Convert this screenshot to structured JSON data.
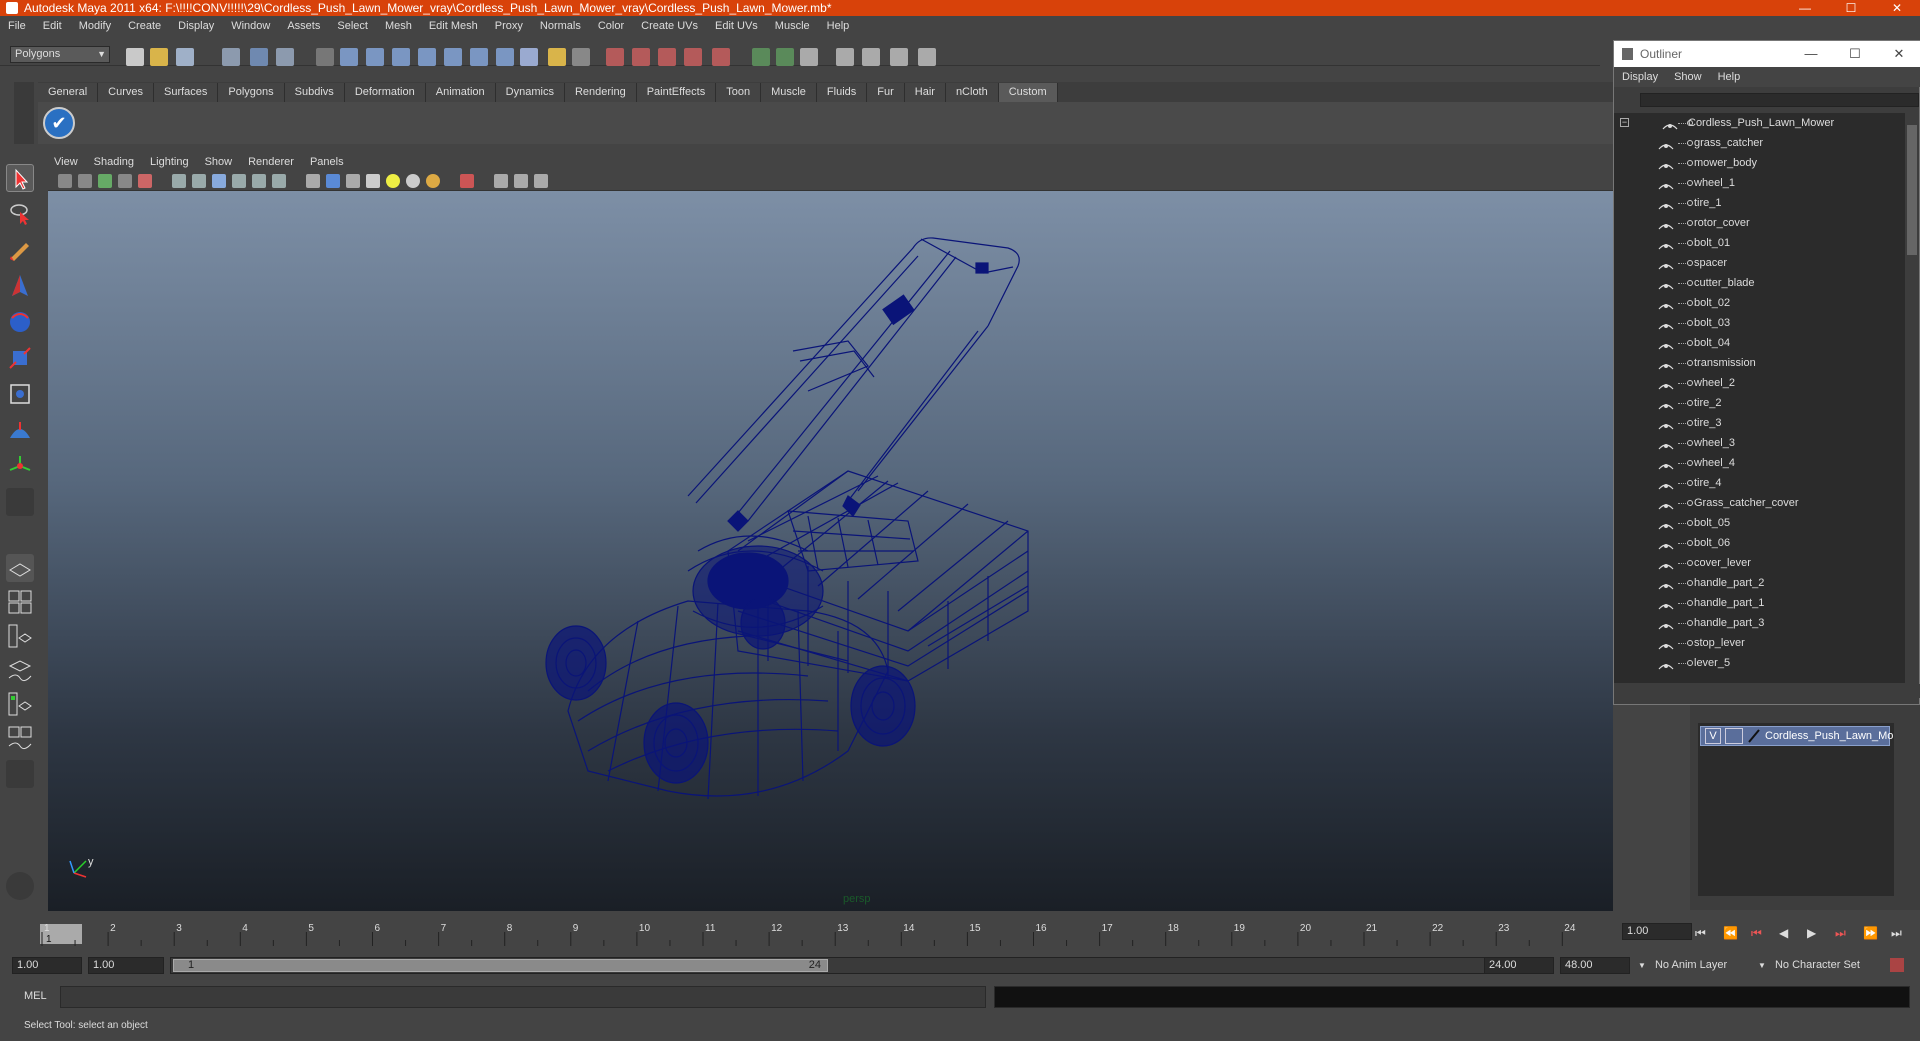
{
  "window": {
    "title": "Autodesk Maya 2011 x64: F:\\!!!!CONV!!!!!\\29\\Cordless_Push_Lawn_Mower_vray\\Cordless_Push_Lawn_Mower_vray\\Cordless_Push_Lawn_Mower.mb*",
    "minimize": "—",
    "maximize": "☐",
    "close": "✕"
  },
  "menubar": [
    "File",
    "Edit",
    "Modify",
    "Create",
    "Display",
    "Window",
    "Assets",
    "Select",
    "Mesh",
    "Edit Mesh",
    "Proxy",
    "Normals",
    "Color",
    "Create UVs",
    "Edit UVs",
    "Muscle",
    "Help"
  ],
  "statusline": {
    "mode": "Polygons"
  },
  "shelf": {
    "tabs": [
      "General",
      "Curves",
      "Surfaces",
      "Polygons",
      "Subdivs",
      "Deformation",
      "Animation",
      "Dynamics",
      "Rendering",
      "PaintEffects",
      "Toon",
      "Muscle",
      "Fluids",
      "Fur",
      "Hair",
      "nCloth",
      "Custom"
    ],
    "active_tab": "Custom",
    "icon": "✔"
  },
  "viewport": {
    "menu": [
      "View",
      "Shading",
      "Lighting",
      "Show",
      "Renderer",
      "Panels"
    ],
    "camera_label": "persp",
    "axis_y": "y",
    "wire_color": "#0a1478"
  },
  "timeslider": {
    "ticks": [
      "1",
      "2",
      "3",
      "4",
      "5",
      "6",
      "7",
      "8",
      "9",
      "10",
      "11",
      "12",
      "13",
      "14",
      "15",
      "16",
      "17",
      "18",
      "19",
      "20",
      "21",
      "22",
      "23",
      "24"
    ],
    "current_frame": "1",
    "current_time_field": "1.00"
  },
  "range": {
    "start_time": "1.00",
    "playback_start": "1.00",
    "slider_start": "1",
    "slider_end": "24",
    "playback_end": "24.00",
    "end_time": "48.00",
    "anim_layer": "No Anim Layer",
    "char_set": "No Character Set"
  },
  "mel": {
    "label": "MEL"
  },
  "helpline": "Select Tool: select an object",
  "outliner": {
    "title": "Outliner",
    "menu": [
      "Display",
      "Show",
      "Help"
    ],
    "root": "Cordless_Push_Lawn_Mower",
    "items": [
      "grass_catcher",
      "mower_body",
      "wheel_1",
      "tire_1",
      "rotor_cover",
      "bolt_01",
      "spacer",
      "cutter_blade",
      "bolt_02",
      "bolt_03",
      "bolt_04",
      "transmission",
      "wheel_2",
      "tire_2",
      "tire_3",
      "wheel_3",
      "wheel_4",
      "tire_4",
      "Grass_catcher_cover",
      "bolt_05",
      "bolt_06",
      "cover_lever",
      "handle_part_2",
      "handle_part_1",
      "handle_part_3",
      "stop_lever",
      "lever_5"
    ]
  },
  "layers": {
    "visible": "V",
    "name": "Cordless_Push_Lawn_Mo"
  },
  "playback_icons": [
    "⏮",
    "⏪",
    "⏮",
    "◀",
    "▶",
    "⏭",
    "⏩",
    "⏭"
  ]
}
